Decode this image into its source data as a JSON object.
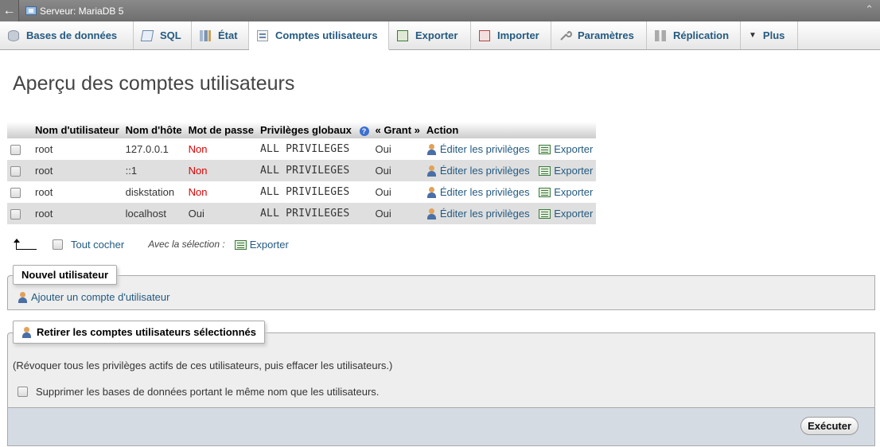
{
  "topbar": {
    "back_icon": "←",
    "server_label": "Serveur: MariaDB 5",
    "collapse_icon": "⌃"
  },
  "tabs": [
    {
      "label": "Bases de données",
      "icon": "database-icon"
    },
    {
      "label": "SQL",
      "icon": "sql-icon"
    },
    {
      "label": "État",
      "icon": "status-icon"
    },
    {
      "label": "Comptes utilisateurs",
      "icon": "users-icon",
      "active": true
    },
    {
      "label": "Exporter",
      "icon": "export-icon"
    },
    {
      "label": "Importer",
      "icon": "import-icon"
    },
    {
      "label": "Paramètres",
      "icon": "wrench-icon"
    },
    {
      "label": "Réplication",
      "icon": "replication-icon"
    },
    {
      "label": "Plus",
      "icon": "triangle-down-icon"
    }
  ],
  "page_title": "Aperçu des comptes utilisateurs",
  "table": {
    "headers": {
      "user": "Nom d'utilisateur",
      "host": "Nom d'hôte",
      "password": "Mot de passe",
      "privileges": "Privilèges globaux",
      "help": "?",
      "grant": "« Grant »",
      "action": "Action"
    },
    "rows": [
      {
        "user": "root",
        "host": "127.0.0.1",
        "password": "Non",
        "privileges": "ALL PRIVILEGES",
        "grant": "Oui",
        "edit": "Éditer les privilèges",
        "export": "Exporter"
      },
      {
        "user": "root",
        "host": "::1",
        "password": "Non",
        "privileges": "ALL PRIVILEGES",
        "grant": "Oui",
        "edit": "Éditer les privilèges",
        "export": "Exporter"
      },
      {
        "user": "root",
        "host": "diskstation",
        "password": "Non",
        "privileges": "ALL PRIVILEGES",
        "grant": "Oui",
        "edit": "Éditer les privilèges",
        "export": "Exporter"
      },
      {
        "user": "root",
        "host": "localhost",
        "password": "Oui",
        "privileges": "ALL PRIVILEGES",
        "grant": "Oui",
        "edit": "Éditer les privilèges",
        "export": "Exporter"
      }
    ]
  },
  "bulk": {
    "check_all": "Tout cocher",
    "with_selected": "Avec la sélection :",
    "export": "Exporter"
  },
  "new_user": {
    "legend": "Nouvel utilisateur",
    "add_link": "Ajouter un compte d'utilisateur"
  },
  "remove_users": {
    "legend": "Retirer les comptes utilisateurs sélectionnés",
    "note": "(Révoquer tous les privilèges actifs de ces utilisateurs, puis effacer les utilisateurs.)",
    "drop_db_label": "Supprimer les bases de données portant le même nom que les utilisateurs.",
    "execute": "Exécuter"
  },
  "colors": {
    "link": "#235a81",
    "no_password": "#dd0000",
    "row_alt": "#dfdfdf"
  }
}
